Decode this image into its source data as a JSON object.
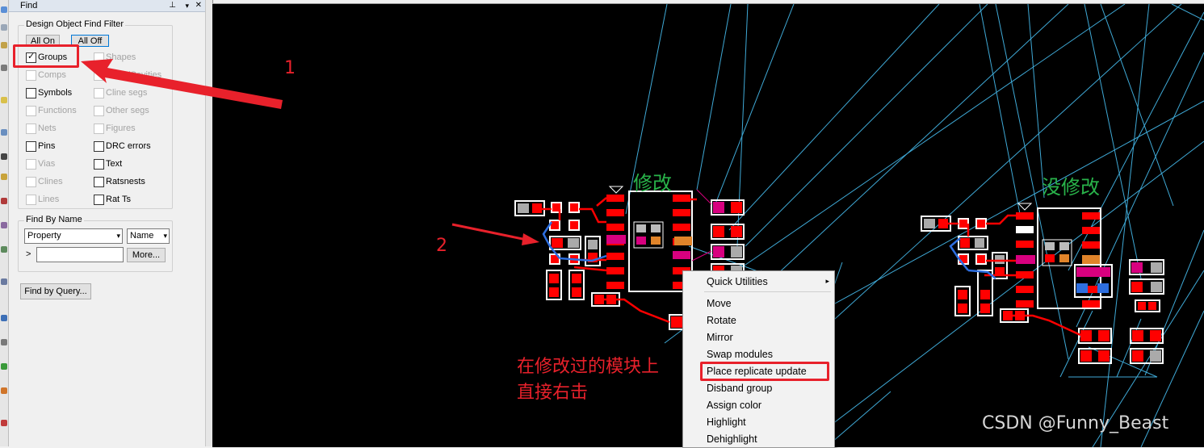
{
  "panel": {
    "title": "Find",
    "pin_icon": "pin-icon",
    "dropdown_icon": "dropdown-icon",
    "close_icon": "close-icon",
    "filter_group_title": "Design Object Find Filter",
    "all_on": "All On",
    "all_off": "All Off",
    "filters_left": [
      {
        "label": "Groups",
        "checked": true,
        "enabled": true
      },
      {
        "label": "Comps",
        "checked": false,
        "enabled": false
      },
      {
        "label": "Symbols",
        "checked": false,
        "enabled": true
      },
      {
        "label": "Functions",
        "checked": false,
        "enabled": false
      },
      {
        "label": "Nets",
        "checked": false,
        "enabled": false
      },
      {
        "label": "Pins",
        "checked": false,
        "enabled": true
      },
      {
        "label": "Vias",
        "checked": false,
        "enabled": false
      },
      {
        "label": "Clines",
        "checked": false,
        "enabled": false
      },
      {
        "label": "Lines",
        "checked": false,
        "enabled": false
      }
    ],
    "filters_right": [
      {
        "label": "Shapes",
        "checked": false,
        "enabled": false
      },
      {
        "label": "Voids/Cavities",
        "checked": false,
        "enabled": false
      },
      {
        "label": "Cline segs",
        "checked": false,
        "enabled": false
      },
      {
        "label": "Other segs",
        "checked": false,
        "enabled": false
      },
      {
        "label": "Figures",
        "checked": false,
        "enabled": false
      },
      {
        "label": "DRC errors",
        "checked": false,
        "enabled": true
      },
      {
        "label": "Text",
        "checked": false,
        "enabled": true
      },
      {
        "label": "Ratsnests",
        "checked": false,
        "enabled": true
      },
      {
        "label": "Rat Ts",
        "checked": false,
        "enabled": true
      }
    ],
    "find_by_name_title": "Find By Name",
    "property_select": "Property",
    "name_select": "Name",
    "prompt_glyph": ">",
    "name_input_value": "",
    "more_button": "More...",
    "find_by_query_button": "Find by Query..."
  },
  "context_menu": {
    "items": [
      {
        "label": "Quick Utilities",
        "submenu": true
      },
      {
        "label": "Move"
      },
      {
        "label": "Rotate"
      },
      {
        "label": "Mirror"
      },
      {
        "label": "Swap modules"
      },
      {
        "label": "Place replicate update",
        "highlighted": true
      },
      {
        "label": "Disband group"
      },
      {
        "label": "Assign color"
      },
      {
        "label": "Highlight"
      },
      {
        "label": "Dehighlight"
      }
    ],
    "submenu_glyph": "▸"
  },
  "annotations": {
    "step1": "1",
    "step2": "2",
    "modified_label": "修改",
    "unmodified_label": "没修改",
    "instruction_line1": "在修改过的模块上",
    "instruction_line2": "直接右击",
    "watermark": "CSDN @Funny_Beast"
  },
  "colors": {
    "annotation_red": "#e8212b",
    "label_green": "#29b34a",
    "pad_red": "#ff0000",
    "magenta": "#d8007f",
    "orange": "#e0842a",
    "ratsnest_cyan": "#3fa9d6",
    "canvas_bg": "#000000"
  }
}
